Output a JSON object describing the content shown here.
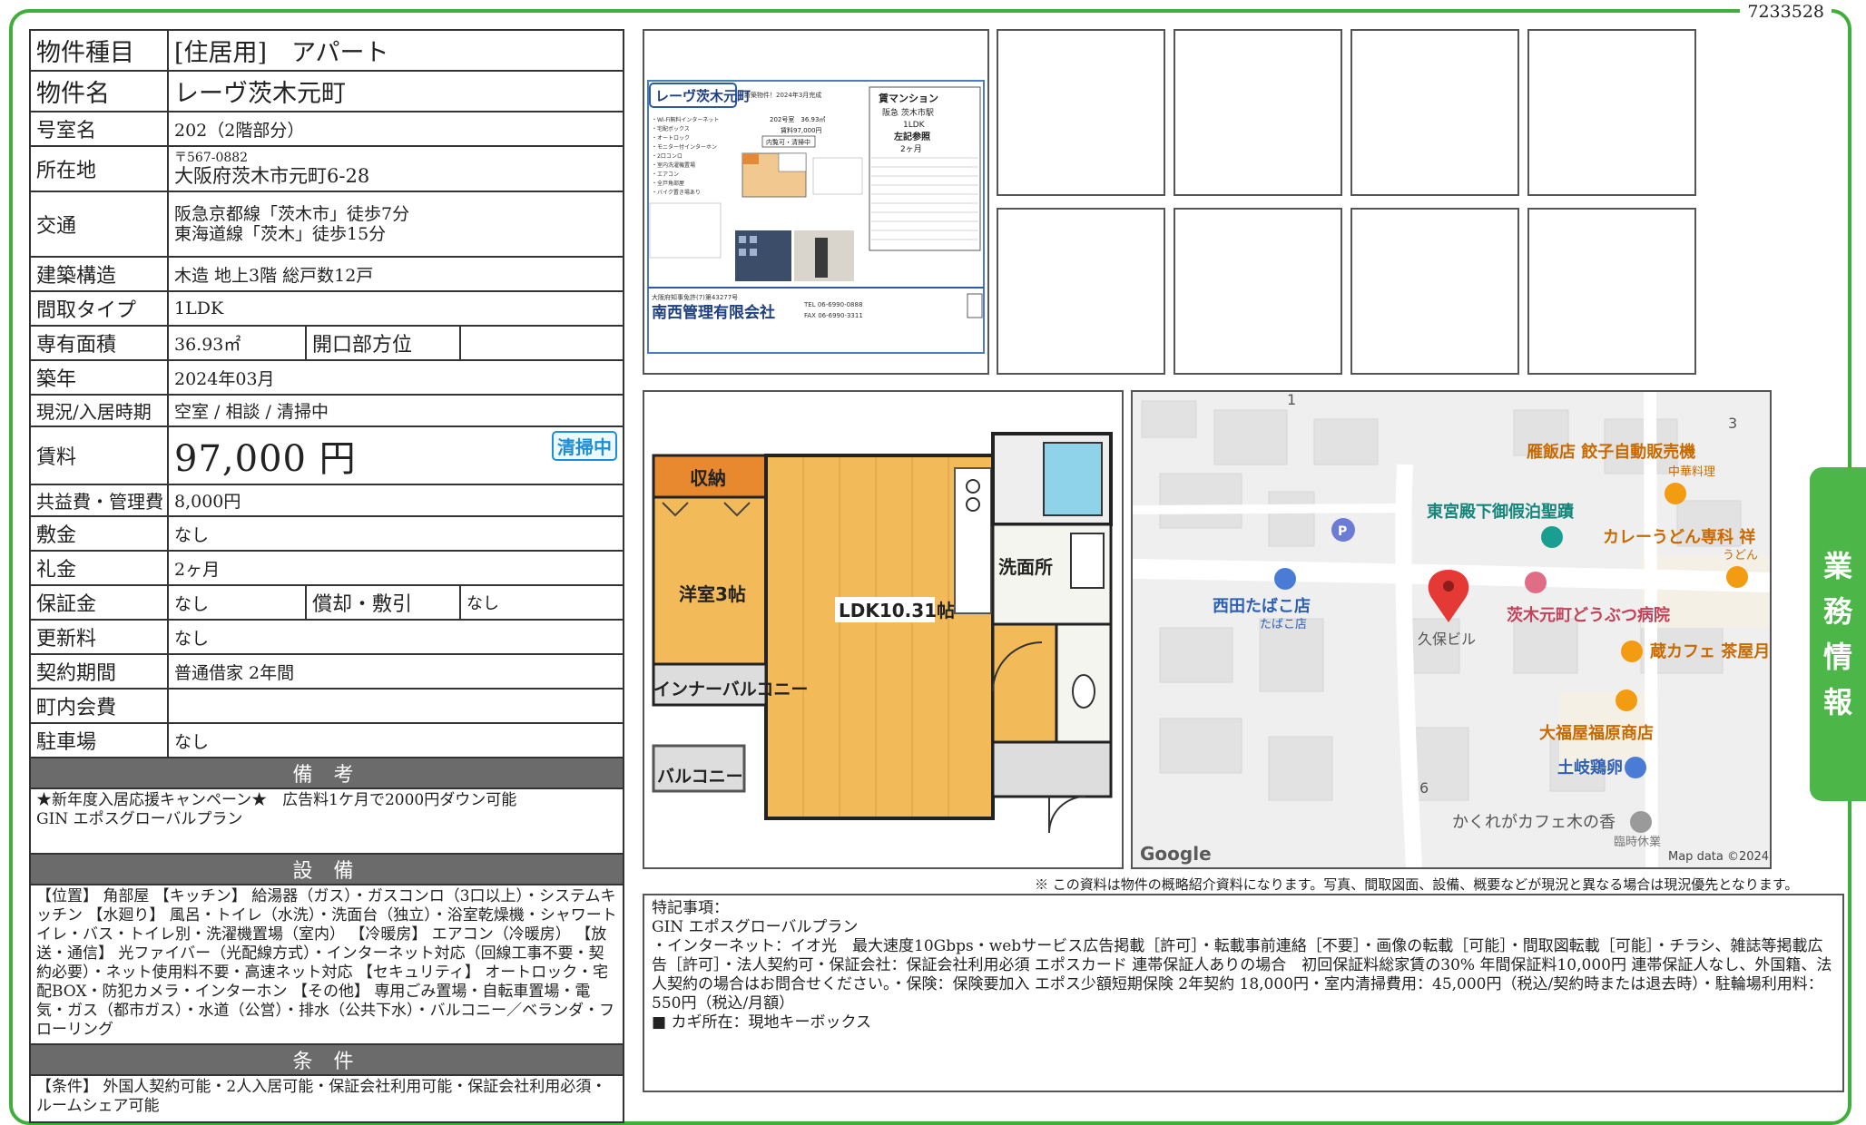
{
  "doc_id": "7233528",
  "property": {
    "type_label": "物件種目",
    "type_value": "[住居用]　アパート",
    "name_label": "物件名",
    "name_value": "レーヴ茨木元町",
    "room_label": "号室名",
    "room_value": "202（2階部分）",
    "address_label": "所在地",
    "postal": "〒567-0882",
    "address": "大阪府茨木市元町6-28",
    "access_label": "交通",
    "access_1": "阪急京都線「茨木市」徒歩7分",
    "access_2": "東海道線「茨木」徒歩15分",
    "structure_label": "建築構造",
    "structure_value": "木造 地上3階 総戸数12戸",
    "layout_label": "間取タイプ",
    "layout_value": "1LDK",
    "area_label": "専有面積",
    "area_value": "36.93㎡",
    "direction_label": "開口部方位",
    "direction_value": "",
    "built_label": "築年",
    "built_value": "2024年03月",
    "status_label": "現況/入居時期",
    "status_value": "空室 / 相談 / 清掃中",
    "rent_label": "賃料",
    "rent_value": "97,000 円",
    "clean_badge": "清掃中",
    "common_label": "共益費・管理費",
    "common_value": "8,000円",
    "deposit_label": "敷金",
    "deposit_value": "なし",
    "key_money_label": "礼金",
    "key_money_value": "2ヶ月",
    "guarantee_label": "保証金",
    "guarantee_value": "なし",
    "amort_label": "償却・敷引",
    "amort_value": "なし",
    "renewal_label": "更新料",
    "renewal_value": "なし",
    "contract_label": "契約期間",
    "contract_value": "普通借家 2年間",
    "town_fee_label": "町内会費",
    "town_fee_value": "",
    "parking_label": "駐車場",
    "parking_value": "なし"
  },
  "remarks": {
    "title": "備 考",
    "line1": "★新年度入居応援キャンペーン★　広告料1ケ月で2000円ダウン可能",
    "line2": "GIN エポスグローバルプラン"
  },
  "equipment": {
    "title": "設 備",
    "text": "【位置】 角部屋 【キッチン】 給湯器（ガス）・ガスコンロ（3口以上）・システムキッチン 【水廻り】 風呂・トイレ（水洗）・洗面台（独立）・浴室乾燥機・シャワートイレ・バス・トイレ別・洗濯機置場（室内） 【冷暖房】 エアコン（冷暖房） 【放送・通信】 光ファイバー（光配線方式）・インターネット対応（回線工事不要・契約必要）・ネット使用料不要・高速ネット対応 【セキュリティ】 オートロック・宅配BOX・防犯カメラ・インターホン 【その他】 専用ごみ置場・自転車置場・電気・ガス（都市ガス）・水道（公営）・排水（公共下水）・バルコニー／ベランダ・フローリング"
  },
  "conditions": {
    "title": "条 件",
    "text": "【条件】 外国人契約可能・2人入居可能・保証会社利用可能・保証会社利用必須・ルームシェア可能"
  },
  "flyer": {
    "name": "レーヴ茨木元町",
    "new_note": "新築物件！2024年3月完成",
    "kind": "賃マンション",
    "station": "阪急 茨木市駅",
    "layout": "1LDK",
    "see": "左記参照",
    "months": "2ヶ月",
    "room_area": "202号室　36.93㎡",
    "rent": "賃料97,000円",
    "visit": "内覧可・清掃中",
    "company": "南西管理有限会社",
    "license": "大阪府知事免許(7)第43277号",
    "tel": "TEL 06-6990-0888",
    "fax": "FAX 06-6990-3311",
    "features": [
      "・Wi-Fi無料インターネット",
      "・宅配ボックス",
      "・オートロック",
      "・モニター付インターホン",
      "・2口コンロ",
      "・室内洗濯機置場",
      "・エアコン",
      "・全戸角部屋",
      "・バイク置き場あり"
    ]
  },
  "floorplan": {
    "storage": "収納",
    "western": "洋室3帖",
    "ldk": "LDK10.31帖",
    "washroom": "洗面所",
    "inner_balcony": "インナーバルコニー",
    "balcony": "バルコニー"
  },
  "map": {
    "n1": "1",
    "n3": "3",
    "n6": "6",
    "restaurant": "雁飯店 餃子自動販売機",
    "restaurant_sub": "中華料理",
    "lodging": "東宮殿下御假泊聖蹟",
    "udon": "カレーうどん専科 祥",
    "udon_sub": "うどん",
    "tobacco": "西田たばこ店",
    "tobacco_sub": "たばこ店",
    "building": "久保ビル",
    "hospital": "茨木元町どうぶつ病院",
    "cafe": "蔵カフェ 茶屋月",
    "shop": "大福屋福原商店",
    "chicken": "土岐鶏卵",
    "hidden_cafe": "かくれがカフェ木の香",
    "closed": "臨時休業",
    "google": "Google",
    "map_data": "Map data ©2024",
    "colors": {
      "marker": "#e53935",
      "poi_orange": "#f39c12",
      "poi_blue": "#4a7cd6",
      "poi_teal": "#1a9e8f"
    }
  },
  "disclaimer": "※ この資料は物件の概略紹介資料になります。写真、間取図面、設備、概要などが現況と異なる場合は現況優先となります。",
  "notes": {
    "title": "特記事項：",
    "line1": "GIN エポスグローバルプラン",
    "line2": "・インターネット：イオ光　最大速度10Gbps・webサービス広告掲載［許可］・転載事前連絡［不要］・画像の転載［可能］・間取図転載［可能］・チラシ、雑誌等掲載広告［許可］・法人契約可・保証会社：保証会社利用必須 エポスカード 連帯保証人ありの場合　初回保証料総家賃の30% 年間保証料10,000円 連帯保証人なし、外国籍、法人契約の場合はお問合せください。・保険：保険要加入 エポス少額短期保険 2年契約 18,000円・室内清掃費用：45,000円（税込/契約時または退去時）・駐輪場利用料：550円（税込/月額）",
    "line3": "■ カギ所在：現地キーボックス"
  },
  "side_tab": [
    "業",
    "務",
    "情",
    "報"
  ],
  "accent_green": "#4cb748"
}
